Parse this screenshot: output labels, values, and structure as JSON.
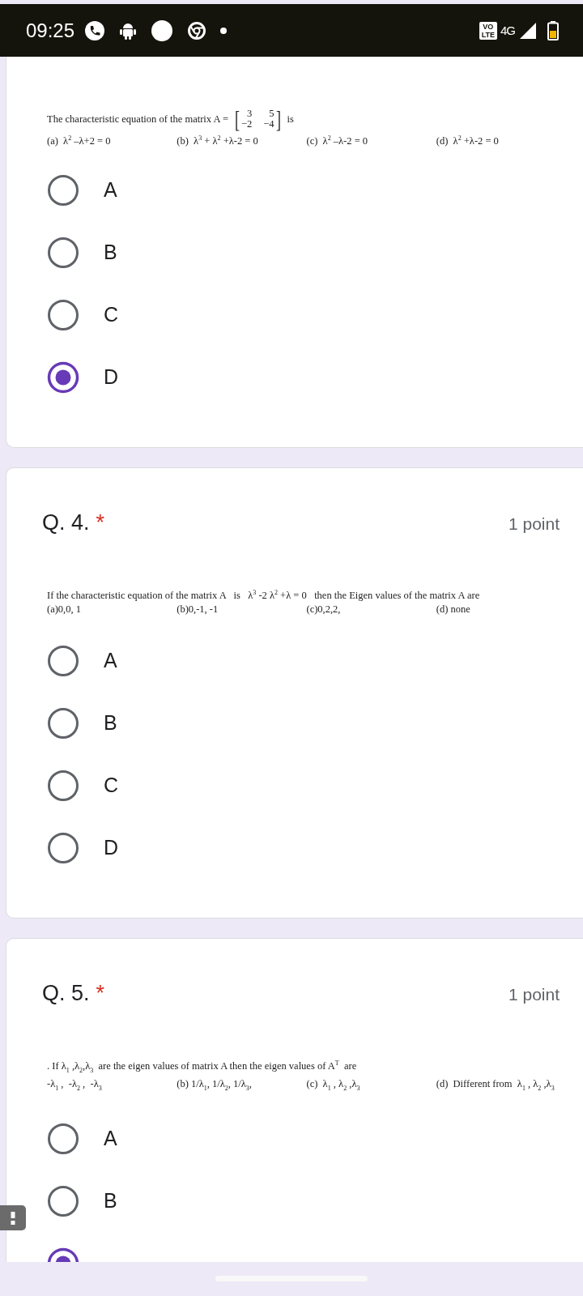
{
  "status_bar": {
    "time": "09:25",
    "volte": [
      "VO",
      "LTE"
    ],
    "network": "4G"
  },
  "questions": [
    {
      "prompt": {
        "kind": "matrix",
        "before": "The characteristic equation of the matrix A =",
        "brackets": [
          "[",
          "]"
        ],
        "matrix": [
          [
            "3",
            "5"
          ],
          [
            "−2",
            "−4"
          ]
        ],
        "after": "is"
      },
      "choices": [
        "(a)  λ$^{2}$ –λ+2 = 0",
        "(b)  λ$^{3}$ + λ$^{2}$ +λ-2 = 0",
        "(c)  λ$^{2}$ –λ-2 = 0",
        "(d)  λ$^{2}$ +λ-2 = 0"
      ],
      "options": [
        {
          "label": "A",
          "selected": false
        },
        {
          "label": "B",
          "selected": false
        },
        {
          "label": "C",
          "selected": false
        },
        {
          "label": "D",
          "selected": true
        }
      ]
    },
    {
      "title": "Q. 4.",
      "required_mark": "*",
      "points": "1 point",
      "prompt": {
        "kind": "text",
        "text": "If the characteristic equation of the matrix A   is   λ$^{3}$ -2 λ$^{2}$ +λ = 0   then the Eigen values of the matrix A are"
      },
      "choices": [
        "(a)0,0, 1",
        "(b)0,-1, -1",
        "(c)0,2,2,",
        "(d) none"
      ],
      "options": [
        {
          "label": "A",
          "selected": false
        },
        {
          "label": "B",
          "selected": false
        },
        {
          "label": "C",
          "selected": false
        },
        {
          "label": "D",
          "selected": false
        }
      ]
    },
    {
      "title": "Q. 5.",
      "required_mark": "*",
      "points": "1 point",
      "prompt": {
        "kind": "text",
        "text": ". If λ$_{1}$ ,λ$_{2}$,λ$_{3}$  are the eigen values of matrix A then the eigen values of A$^{T}$  are"
      },
      "choices": [
        "-λ$_{1}$ ,  -λ$_{2}$ ,  -λ$_{3}$",
        "(b) 1/λ$_{1}$, 1/λ$_{2}$, 1/λ$_{3}$,",
        "(c)  λ$_{1}$ , λ$_{2}$ ,λ$_{3}$",
        "(d)  Different from  λ$_{1}$ , λ$_{2}$ ,λ$_{3}$"
      ],
      "options": [
        {
          "label": "A",
          "selected": false
        },
        {
          "label": "B",
          "selected": false
        },
        {
          "selected": true
        }
      ]
    }
  ]
}
